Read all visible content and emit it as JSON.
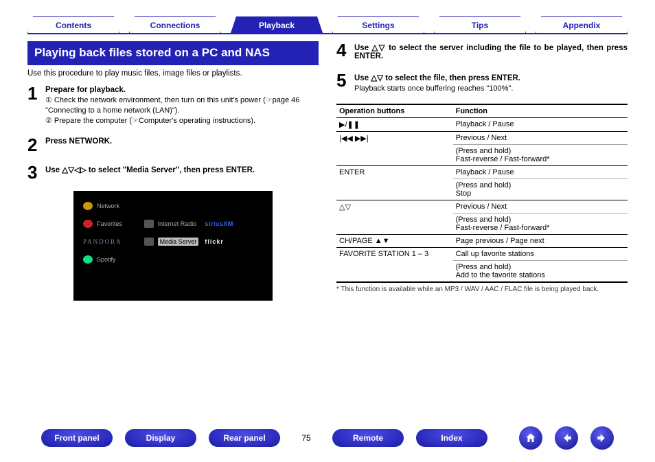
{
  "tabs": [
    "Contents",
    "Connections",
    "Playback",
    "Settings",
    "Tips",
    "Appendix"
  ],
  "active_tab_index": 2,
  "section_title": "Playing back files stored on a PC and NAS",
  "intro": "Use this procedure to play music files, image files or playlists.",
  "steps_left": [
    {
      "n": "1",
      "head": "Prepare for playback.",
      "subs": [
        "① Check the network environment, then turn on this unit's power (☞page 46 \"Connecting to a home network (LAN)\").",
        "② Prepare the computer (☞Computer's operating instructions)."
      ]
    },
    {
      "n": "2",
      "head": "Press NETWORK.",
      "subs": []
    },
    {
      "n": "3",
      "head": "Use △▽◁▷ to select \"Media Server\", then press ENTER.",
      "subs": []
    }
  ],
  "steps_right": [
    {
      "n": "4",
      "head": "Use △▽ to select the server including the file to be played, then press ENTER.",
      "subs": []
    },
    {
      "n": "5",
      "head": "Use △▽ to select the file, then press ENTER.",
      "subs": [
        "Playback starts once buffering reaches \"100%\"."
      ]
    }
  ],
  "screen": {
    "title": "Network",
    "favorites": "Favorites",
    "iradio": "Internet Radio",
    "sxm": "siriusXM",
    "pandora": "PANDORA",
    "mediaserver": "Media Server",
    "flickr": "flickr",
    "spotify": "Spotify"
  },
  "table": {
    "headers": [
      "Operation buttons",
      "Function"
    ],
    "rows": [
      {
        "btn": "▶/❚❚",
        "fns": [
          "Playback / Pause"
        ]
      },
      {
        "btn": "|◀◀  ▶▶|",
        "fns": [
          "Previous / Next",
          "(Press and hold)\nFast-reverse / Fast-forward*"
        ]
      },
      {
        "btn": "ENTER",
        "fns": [
          "Playback / Pause",
          "(Press and hold)\nStop"
        ]
      },
      {
        "btn": "△▽",
        "fns": [
          "Previous / Next",
          "(Press and hold)\nFast-reverse / Fast-forward*"
        ]
      },
      {
        "btn": "CH/PAGE ▲▼",
        "fns": [
          "Page previous / Page next"
        ]
      },
      {
        "btn": "FAVORITE STATION 1 – 3",
        "fns": [
          "Call up favorite stations",
          "(Press and hold)\nAdd to the favorite stations"
        ]
      }
    ]
  },
  "footnote": "* This function is available while an MP3 / WAV / AAC / FLAC file is being played back.",
  "bottom_pills": [
    "Front panel",
    "Display",
    "Rear panel",
    "Remote",
    "Index"
  ],
  "page_number": "75"
}
